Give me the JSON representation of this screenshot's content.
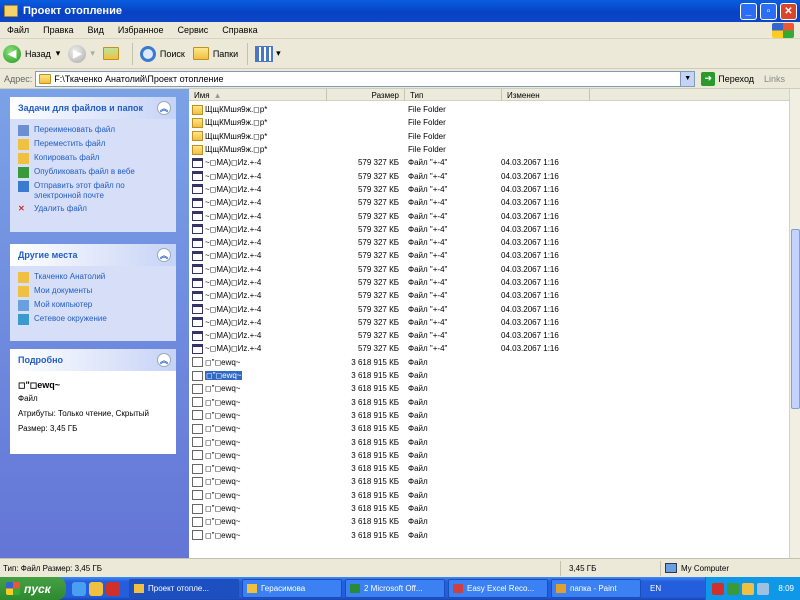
{
  "window": {
    "title": "Проект отопление"
  },
  "menu": [
    "Файл",
    "Правка",
    "Вид",
    "Избранное",
    "Сервис",
    "Справка"
  ],
  "toolbar": {
    "back": "Назад",
    "search": "Поиск",
    "folders": "Папки"
  },
  "address": {
    "label": "Адрес:",
    "path": "F:\\Ткаченко Анатолий\\Проект отопление",
    "go": "Переход",
    "links": "Links"
  },
  "tasks_panel": {
    "title": "Задачи для файлов и папок",
    "items": [
      {
        "label": "Переименовать файл",
        "icon": "rename-icon"
      },
      {
        "label": "Переместить файл",
        "icon": "move-icon"
      },
      {
        "label": "Копировать файл",
        "icon": "copy-icon"
      },
      {
        "label": "Опубликовать файл в вебе",
        "icon": "web-icon"
      },
      {
        "label": "Отправить этот файл по электронной почте",
        "icon": "email-icon"
      },
      {
        "label": "Удалить файл",
        "icon": "delete-icon"
      }
    ]
  },
  "places_panel": {
    "title": "Другие места",
    "items": [
      {
        "label": "Ткаченко Анатолий",
        "icon": "folder-icon"
      },
      {
        "label": "Мои документы",
        "icon": "folder-icon"
      },
      {
        "label": "Мой компьютер",
        "icon": "computer-icon"
      },
      {
        "label": "Сетевое окружение",
        "icon": "network-icon"
      }
    ]
  },
  "details_panel": {
    "title": "Подробно",
    "name": "◻\"◻ewq~",
    "type": "Файл",
    "attributes": "Атрибуты: Только чтение, Скрытый",
    "size": "Размер: 3,45 ГБ"
  },
  "columns": {
    "name": "Имя",
    "size": "Размер",
    "type": "Тип",
    "modified": "Изменен"
  },
  "files": [
    {
      "name": "ЩщКМшя9ж.◻р*",
      "size": "",
      "type": "File Folder",
      "date": "",
      "icon": "folder"
    },
    {
      "name": "ЩщКМшя9ж.◻р*",
      "size": "",
      "type": "File Folder",
      "date": "",
      "icon": "folder"
    },
    {
      "name": "ЩщКМшя9ж.◻р*",
      "size": "",
      "type": "File Folder",
      "date": "",
      "icon": "folder"
    },
    {
      "name": "ЩщКМшя9ж.◻р*",
      "size": "",
      "type": "File Folder",
      "date": "",
      "icon": "folder"
    },
    {
      "name": "~◻МА)◻Иz.+-4",
      "size": "579 327 КБ",
      "type": "Файл \"+-4\"",
      "date": "04.03.2067 1:16",
      "icon": "file44"
    },
    {
      "name": "~◻МА)◻Иz.+-4",
      "size": "579 327 КБ",
      "type": "Файл \"+-4\"",
      "date": "04.03.2067 1:16",
      "icon": "file44"
    },
    {
      "name": "~◻МА)◻Иz.+-4",
      "size": "579 327 КБ",
      "type": "Файл \"+-4\"",
      "date": "04.03.2067 1:16",
      "icon": "file44"
    },
    {
      "name": "~◻МА)◻Иz.+-4",
      "size": "579 327 КБ",
      "type": "Файл \"+-4\"",
      "date": "04.03.2067 1:16",
      "icon": "file44"
    },
    {
      "name": "~◻МА)◻Иz.+-4",
      "size": "579 327 КБ",
      "type": "Файл \"+-4\"",
      "date": "04.03.2067 1:16",
      "icon": "file44"
    },
    {
      "name": "~◻МА)◻Иz.+-4",
      "size": "579 327 КБ",
      "type": "Файл \"+-4\"",
      "date": "04.03.2067 1:16",
      "icon": "file44"
    },
    {
      "name": "~◻МА)◻Иz.+-4",
      "size": "579 327 КБ",
      "type": "Файл \"+-4\"",
      "date": "04.03.2067 1:16",
      "icon": "file44"
    },
    {
      "name": "~◻МА)◻Иz.+-4",
      "size": "579 327 КБ",
      "type": "Файл \"+-4\"",
      "date": "04.03.2067 1:16",
      "icon": "file44"
    },
    {
      "name": "~◻МА)◻Иz.+-4",
      "size": "579 327 КБ",
      "type": "Файл \"+-4\"",
      "date": "04.03.2067 1:16",
      "icon": "file44"
    },
    {
      "name": "~◻МА)◻Иz.+-4",
      "size": "579 327 КБ",
      "type": "Файл \"+-4\"",
      "date": "04.03.2067 1:16",
      "icon": "file44"
    },
    {
      "name": "~◻МА)◻Иz.+-4",
      "size": "579 327 КБ",
      "type": "Файл \"+-4\"",
      "date": "04.03.2067 1:16",
      "icon": "file44"
    },
    {
      "name": "~◻МА)◻Иz.+-4",
      "size": "579 327 КБ",
      "type": "Файл \"+-4\"",
      "date": "04.03.2067 1:16",
      "icon": "file44"
    },
    {
      "name": "~◻МА)◻Иz.+-4",
      "size": "579 327 КБ",
      "type": "Файл \"+-4\"",
      "date": "04.03.2067 1:16",
      "icon": "file44"
    },
    {
      "name": "~◻МА)◻Иz.+-4",
      "size": "579 327 КБ",
      "type": "Файл \"+-4\"",
      "date": "04.03.2067 1:16",
      "icon": "file44"
    },
    {
      "name": "~◻МА)◻Иz.+-4",
      "size": "579 327 КБ",
      "type": "Файл \"+-4\"",
      "date": "04.03.2067 1:16",
      "icon": "file44"
    },
    {
      "name": "◻\"◻ewq~",
      "size": "3 618 915 КБ",
      "type": "Файл",
      "date": "",
      "icon": "file"
    },
    {
      "name": "◻\"◻ewq~",
      "size": "3 618 915 КБ",
      "type": "Файл",
      "date": "",
      "icon": "file",
      "selected": true
    },
    {
      "name": "◻\"◻ewq~",
      "size": "3 618 915 КБ",
      "type": "Файл",
      "date": "",
      "icon": "file"
    },
    {
      "name": "◻\"◻ewq~",
      "size": "3 618 915 КБ",
      "type": "Файл",
      "date": "",
      "icon": "file"
    },
    {
      "name": "◻\"◻ewq~",
      "size": "3 618 915 КБ",
      "type": "Файл",
      "date": "",
      "icon": "file"
    },
    {
      "name": "◻\"◻ewq~",
      "size": "3 618 915 КБ",
      "type": "Файл",
      "date": "",
      "icon": "file"
    },
    {
      "name": "◻\"◻ewq~",
      "size": "3 618 915 КБ",
      "type": "Файл",
      "date": "",
      "icon": "file"
    },
    {
      "name": "◻\"◻ewq~",
      "size": "3 618 915 КБ",
      "type": "Файл",
      "date": "",
      "icon": "file"
    },
    {
      "name": "◻\"◻ewq~",
      "size": "3 618 915 КБ",
      "type": "Файл",
      "date": "",
      "icon": "file"
    },
    {
      "name": "◻\"◻ewq~",
      "size": "3 618 915 КБ",
      "type": "Файл",
      "date": "",
      "icon": "file"
    },
    {
      "name": "◻\"◻ewq~",
      "size": "3 618 915 КБ",
      "type": "Файл",
      "date": "",
      "icon": "file"
    },
    {
      "name": "◻\"◻ewq~",
      "size": "3 618 915 КБ",
      "type": "Файл",
      "date": "",
      "icon": "file"
    },
    {
      "name": "◻\"◻ewq~",
      "size": "3 618 915 КБ",
      "type": "Файл",
      "date": "",
      "icon": "file"
    },
    {
      "name": "◻\"◻ewq~",
      "size": "3 618 915 КБ",
      "type": "Файл",
      "date": "",
      "icon": "file"
    }
  ],
  "status": {
    "left": "Тип: Файл Размер: 3,45 ГБ",
    "size": "3,45 ГБ",
    "location": "My Computer"
  },
  "taskbar": {
    "start": "пуск",
    "tasks": [
      {
        "label": "Проект отопле...",
        "active": true
      },
      {
        "label": "Герасимова",
        "active": false
      },
      {
        "label": "2 Microsoft Off...",
        "active": false
      },
      {
        "label": "Easy Excel Reco...",
        "active": false
      },
      {
        "label": "папка - Paint",
        "active": false
      }
    ],
    "lang": "EN",
    "clock": "8:09"
  }
}
